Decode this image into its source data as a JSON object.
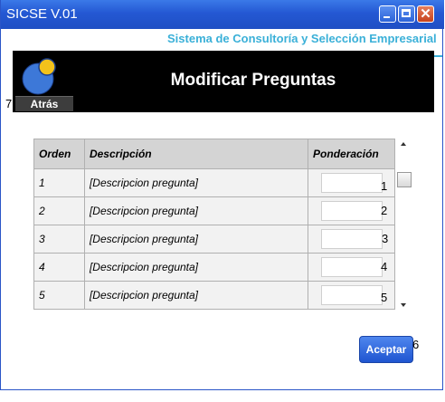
{
  "window": {
    "title": "SICSE V.01"
  },
  "header": {
    "subtitle": "Sistema de Consultoría y Selección Empresarial",
    "page_title": "Modificar Preguntas",
    "back_label": "Atrás"
  },
  "table": {
    "headers": [
      "Orden",
      "Descripción",
      "Ponderación"
    ],
    "rows": [
      {
        "orden": "1",
        "descripcion": "[Descripcion pregunta]",
        "ponderacion": ""
      },
      {
        "orden": "2",
        "descripcion": "[Descripcion pregunta]",
        "ponderacion": ""
      },
      {
        "orden": "3",
        "descripcion": "[Descripcion pregunta]",
        "ponderacion": ""
      },
      {
        "orden": "4",
        "descripcion": "[Descripcion pregunta]",
        "ponderacion": ""
      },
      {
        "orden": "5",
        "descripcion": "[Descripcion pregunta]",
        "ponderacion": ""
      }
    ]
  },
  "markers": [
    "1",
    "2",
    "3",
    "4",
    "5",
    "6",
    "7"
  ],
  "actions": {
    "accept_label": "Aceptar"
  },
  "icons": {
    "logo": "logo-icon",
    "minimize": "minimize-icon",
    "maximize": "maximize-icon",
    "close": "close-icon"
  },
  "colors": {
    "titlebar": "#2458d3",
    "subtitle": "#3ab0d8",
    "header_bg": "#000000",
    "logo_blue": "#3d78d8",
    "logo_yellow": "#f3c21b",
    "accept": "#1f55d0"
  }
}
